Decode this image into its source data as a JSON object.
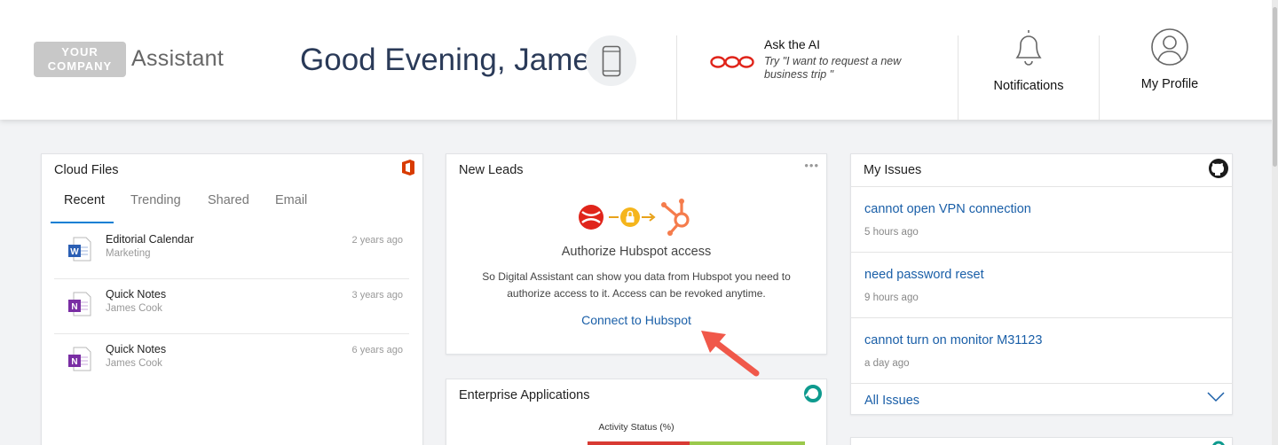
{
  "header": {
    "logo_line1": "YOUR",
    "logo_line2": "COMPANY",
    "app_name": "Assistant",
    "greeting": "Good Evening, James",
    "ai_title": "Ask the AI",
    "ai_prompt": "Try \"I want to request a new business trip \"",
    "notifications_label": "Notifications",
    "profile_label": "My Profile"
  },
  "cloud_files": {
    "title": "Cloud Files",
    "tabs": [
      "Recent",
      "Trending",
      "Shared",
      "Email"
    ],
    "active_tab": "Recent",
    "files": [
      {
        "name": "Editorial Calendar",
        "owner": "Marketing",
        "time": "2 years ago",
        "icon": "word-icon"
      },
      {
        "name": "Quick Notes",
        "owner": "James Cook",
        "time": "3 years ago",
        "icon": "onenote-icon"
      },
      {
        "name": "Quick Notes",
        "owner": "James Cook",
        "time": "6 years ago",
        "icon": "onenote-icon"
      }
    ]
  },
  "new_leads": {
    "title": "New Leads",
    "more": "•••",
    "auth_title": "Authorize Hubspot access",
    "auth_desc": "So Digital Assistant can show you data from Hubspot you need to authorize access to it. Access can be revoked anytime.",
    "connect_label": "Connect to Hubspot"
  },
  "enterprise": {
    "title": "Enterprise Applications",
    "chart_label": "Activity Status (%)"
  },
  "issues": {
    "title": "My Issues",
    "items": [
      {
        "title": "cannot open VPN connection",
        "time": "5 hours ago"
      },
      {
        "title": "need password reset",
        "time": "9 hours ago"
      },
      {
        "title": "cannot turn on monitor M31123",
        "time": "a day ago"
      }
    ],
    "all_label": "All Issues"
  },
  "colors": {
    "link": "#1a5fa8",
    "accent": "#0b7fd4",
    "hubspot": "#f57c4c",
    "ai_red": "#e0251b",
    "arrow": "#f0584a"
  }
}
